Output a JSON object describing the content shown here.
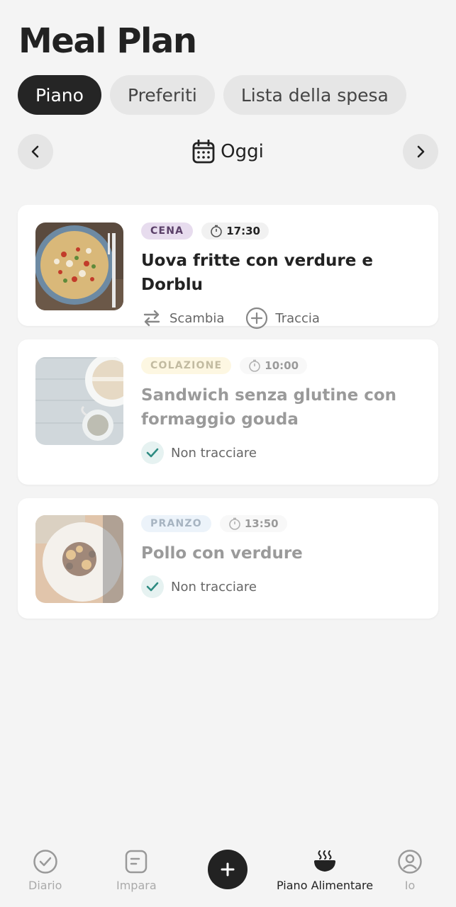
{
  "header": {
    "title": "Meal Plan"
  },
  "tabs": [
    {
      "label": "Piano",
      "active": true
    },
    {
      "label": "Preferiti",
      "active": false
    },
    {
      "label": "Lista della spesa",
      "active": false
    }
  ],
  "day_nav": {
    "label": "Oggi",
    "prev_icon": "chevron-left-icon",
    "next_icon": "chevron-right-icon",
    "calendar_icon": "calendar-icon"
  },
  "meals": [
    {
      "tag": "CENA",
      "tag_bg": "#e7dcee",
      "tag_color": "#5a3f68",
      "time": "17:30",
      "name": "Uova fritte con verdure e Dorblu",
      "actions": {
        "swap": "Scambia",
        "track": "Traccia"
      }
    },
    {
      "tag": "COLAZIONE",
      "tag_bg": "#fcefc0",
      "tag_color": "#7a6a30",
      "time": "10:00",
      "name": "Sandwich senza glutine con formaggio gouda",
      "status": "Non tracciare"
    },
    {
      "tag": "PRANZO",
      "tag_bg": "#d6e6f6",
      "tag_color": "#3d5a78",
      "time": "13:50",
      "name": "Pollo con verdure",
      "status": "Non tracciare"
    }
  ],
  "bottom_nav": [
    {
      "label": "Diario",
      "icon": "check-circle-icon",
      "active": false
    },
    {
      "label": "Impara",
      "icon": "document-icon",
      "active": false
    },
    {
      "label": "",
      "icon": "plus-icon",
      "active": false
    },
    {
      "label": "Piano Alimentare",
      "icon": "bowl-icon",
      "active": true
    },
    {
      "label": "Io",
      "icon": "user-icon",
      "active": false
    }
  ],
  "colors": {
    "accent_dark": "#222222",
    "check": "#2e8b82",
    "background": "#f4f4f4"
  }
}
